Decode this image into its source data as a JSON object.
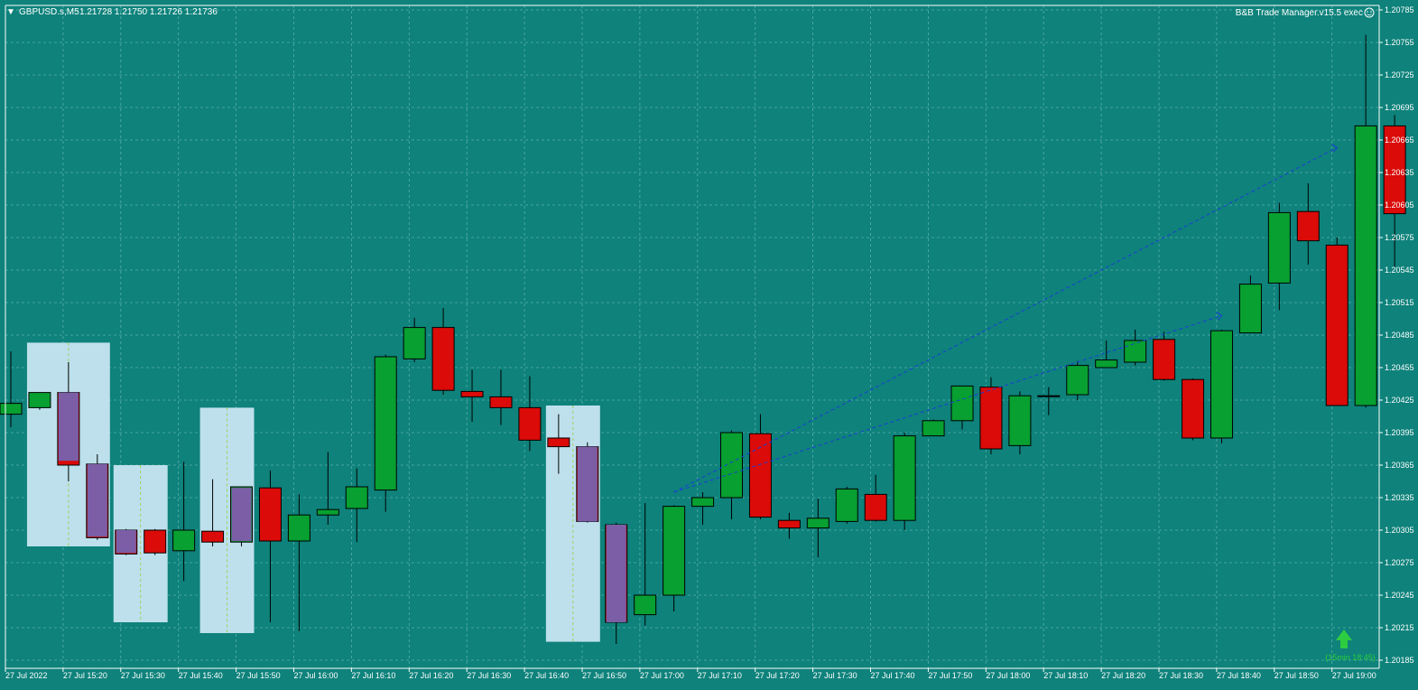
{
  "header": {
    "symbol": "GBPUSD.s,M5",
    "ohlc": "1.21728 1.21750 1.21726 1.21736",
    "ea_label": "B&B Trade Manager.v15.5 exec",
    "signal_label": "(15min 18:45)"
  },
  "colors": {
    "background": "#0e827b",
    "grid": "#58b0aa",
    "bull": "#07a031",
    "bear": "#da0b08",
    "highlight_box": "#bde0ec",
    "purple": "#7b5ea6",
    "trendline": "#1a3fd6",
    "signal_arrow": "#2ecc40"
  },
  "chart_data": {
    "type": "candlestick",
    "timeframe": "M5",
    "x_ticks": [
      "27 Jul 2022",
      "27 Jul 15:20",
      "27 Jul 15:30",
      "27 Jul 15:40",
      "27 Jul 15:50",
      "27 Jul 16:00",
      "27 Jul 16:10",
      "27 Jul 16:20",
      "27 Jul 16:30",
      "27 Jul 16:40",
      "27 Jul 16:50",
      "27 Jul 17:00",
      "27 Jul 17:10",
      "27 Jul 17:20",
      "27 Jul 17:30",
      "27 Jul 17:40",
      "27 Jul 17:50",
      "27 Jul 18:00",
      "27 Jul 18:10",
      "27 Jul 18:20",
      "27 Jul 18:30",
      "27 Jul 18:40",
      "27 Jul 18:50",
      "27 Jul 19:00"
    ],
    "y_ticks": [
      "1.20785",
      "1.20755",
      "1.20725",
      "1.20695",
      "1.20665",
      "1.20635",
      "1.20605",
      "1.20575",
      "1.20545",
      "1.20515",
      "1.20485",
      "1.20455",
      "1.20425",
      "1.20395",
      "1.20365",
      "1.20335",
      "1.20305",
      "1.20275",
      "1.20245",
      "1.20215",
      "1.20185"
    ],
    "ylim": [
      1.20185,
      1.20785
    ],
    "candles": [
      {
        "o": 1.20412,
        "h": 1.2047,
        "l": 1.204,
        "c": 1.20422
      },
      {
        "o": 1.20418,
        "h": 1.2043,
        "l": 1.20416,
        "c": 1.20432
      },
      {
        "o": 1.20432,
        "h": 1.2046,
        "l": 1.2035,
        "c": 1.20365
      },
      {
        "o": 1.20366,
        "h": 1.20375,
        "l": 1.20296,
        "c": 1.20298
      },
      {
        "o": 1.20305,
        "h": 1.20306,
        "l": 1.20282,
        "c": 1.20283
      },
      {
        "o": 1.20305,
        "h": 1.20306,
        "l": 1.20282,
        "c": 1.20284
      },
      {
        "o": 1.20286,
        "h": 1.20368,
        "l": 1.20258,
        "c": 1.20305
      },
      {
        "o": 1.20304,
        "h": 1.20352,
        "l": 1.2029,
        "c": 1.20294
      },
      {
        "o": 1.20294,
        "h": 1.20345,
        "l": 1.2029,
        "c": 1.20345
      },
      {
        "o": 1.20344,
        "h": 1.2036,
        "l": 1.2022,
        "c": 1.20295
      },
      {
        "o": 1.20295,
        "h": 1.20338,
        "l": 1.20212,
        "c": 1.20319
      },
      {
        "o": 1.20319,
        "h": 1.20377,
        "l": 1.2031,
        "c": 1.20324
      },
      {
        "o": 1.20325,
        "h": 1.20362,
        "l": 1.20294,
        "c": 1.20345
      },
      {
        "o": 1.20342,
        "h": 1.20467,
        "l": 1.20322,
        "c": 1.20465
      },
      {
        "o": 1.20463,
        "h": 1.20501,
        "l": 1.2046,
        "c": 1.20492
      },
      {
        "o": 1.20492,
        "h": 1.2051,
        "l": 1.2043,
        "c": 1.20434
      },
      {
        "o": 1.20433,
        "h": 1.20453,
        "l": 1.20405,
        "c": 1.20428
      },
      {
        "o": 1.20428,
        "h": 1.20453,
        "l": 1.20402,
        "c": 1.20418
      },
      {
        "o": 1.20418,
        "h": 1.20447,
        "l": 1.20378,
        "c": 1.20388
      },
      {
        "o": 1.2039,
        "h": 1.20412,
        "l": 1.20357,
        "c": 1.20382
      },
      {
        "o": 1.20382,
        "h": 1.20386,
        "l": 1.20312,
        "c": 1.20313
      },
      {
        "o": 1.2031,
        "h": 1.20312,
        "l": 1.202,
        "c": 1.2022
      },
      {
        "o": 1.20227,
        "h": 1.2033,
        "l": 1.20217,
        "c": 1.20245
      },
      {
        "o": 1.20245,
        "h": 1.20328,
        "l": 1.2023,
        "c": 1.20327
      },
      {
        "o": 1.20327,
        "h": 1.2034,
        "l": 1.2031,
        "c": 1.20335
      },
      {
        "o": 1.20335,
        "h": 1.20397,
        "l": 1.20315,
        "c": 1.20395
      },
      {
        "o": 1.20394,
        "h": 1.20412,
        "l": 1.20315,
        "c": 1.20317
      },
      {
        "o": 1.20314,
        "h": 1.20321,
        "l": 1.20297,
        "c": 1.20307
      },
      {
        "o": 1.20307,
        "h": 1.20334,
        "l": 1.2028,
        "c": 1.20316
      },
      {
        "o": 1.20313,
        "h": 1.20345,
        "l": 1.20311,
        "c": 1.20343
      },
      {
        "o": 1.20338,
        "h": 1.20356,
        "l": 1.20313,
        "c": 1.20314
      },
      {
        "o": 1.20314,
        "h": 1.20395,
        "l": 1.20305,
        "c": 1.20392
      },
      {
        "o": 1.20392,
        "h": 1.20407,
        "l": 1.20392,
        "c": 1.20406
      },
      {
        "o": 1.20406,
        "h": 1.20433,
        "l": 1.20398,
        "c": 1.20438
      },
      {
        "o": 1.20437,
        "h": 1.20446,
        "l": 1.20375,
        "c": 1.2038
      },
      {
        "o": 1.20383,
        "h": 1.20433,
        "l": 1.20375,
        "c": 1.20429
      },
      {
        "o": 1.20429,
        "h": 1.20437,
        "l": 1.20411,
        "c": 1.20429
      },
      {
        "o": 1.2043,
        "h": 1.20461,
        "l": 1.20425,
        "c": 1.20457
      },
      {
        "o": 1.20455,
        "h": 1.2048,
        "l": 1.20455,
        "c": 1.20462
      },
      {
        "o": 1.2046,
        "h": 1.2049,
        "l": 1.20457,
        "c": 1.2048
      },
      {
        "o": 1.20481,
        "h": 1.20488,
        "l": 1.20443,
        "c": 1.20444
      },
      {
        "o": 1.20444,
        "h": 1.20445,
        "l": 1.20388,
        "c": 1.2039
      },
      {
        "o": 1.2039,
        "h": 1.2049,
        "l": 1.20385,
        "c": 1.20489
      },
      {
        "o": 1.20487,
        "h": 1.2054,
        "l": 1.20487,
        "c": 1.20532
      },
      {
        "o": 1.20533,
        "h": 1.20607,
        "l": 1.20508,
        "c": 1.20598
      },
      {
        "o": 1.20599,
        "h": 1.20625,
        "l": 1.2055,
        "c": 1.20572
      },
      {
        "o": 1.20568,
        "h": 1.20575,
        "l": 1.2042,
        "c": 1.2042
      },
      {
        "o": 1.2042,
        "h": 1.20762,
        "l": 1.20418,
        "c": 1.20678
      },
      {
        "o": 1.20678,
        "h": 1.20688,
        "l": 1.20548,
        "c": 1.20597
      }
    ],
    "purple_candles": [
      {
        "i": 2,
        "o": 1.20432,
        "c": 1.20369
      },
      {
        "i": 3,
        "o": 1.20366,
        "c": 1.20299
      },
      {
        "i": 4,
        "o": 1.20305,
        "c": 1.20284
      },
      {
        "i": 8,
        "o": 1.20344,
        "c": 1.20295
      },
      {
        "i": 20,
        "o": 1.20382,
        "c": 1.20313
      },
      {
        "i": 21,
        "o": 1.2031,
        "c": 1.2022
      }
    ],
    "highlight_boxes": [
      {
        "from": 1,
        "to": 3,
        "low": 1.2029,
        "high": 1.20478
      },
      {
        "from": 4,
        "to": 5,
        "low": 1.2022,
        "high": 1.20365
      },
      {
        "from": 7,
        "to": 8,
        "low": 1.2021,
        "high": 1.20418
      },
      {
        "from": 19,
        "to": 20,
        "low": 1.20202,
        "high": 1.2042
      }
    ],
    "trendlines": [
      {
        "x1": 23,
        "y1": 1.2034,
        "x2": 42,
        "y2": 1.20503
      },
      {
        "x1": 23,
        "y1": 1.2034,
        "x2": 46,
        "y2": 1.20658
      }
    ]
  }
}
